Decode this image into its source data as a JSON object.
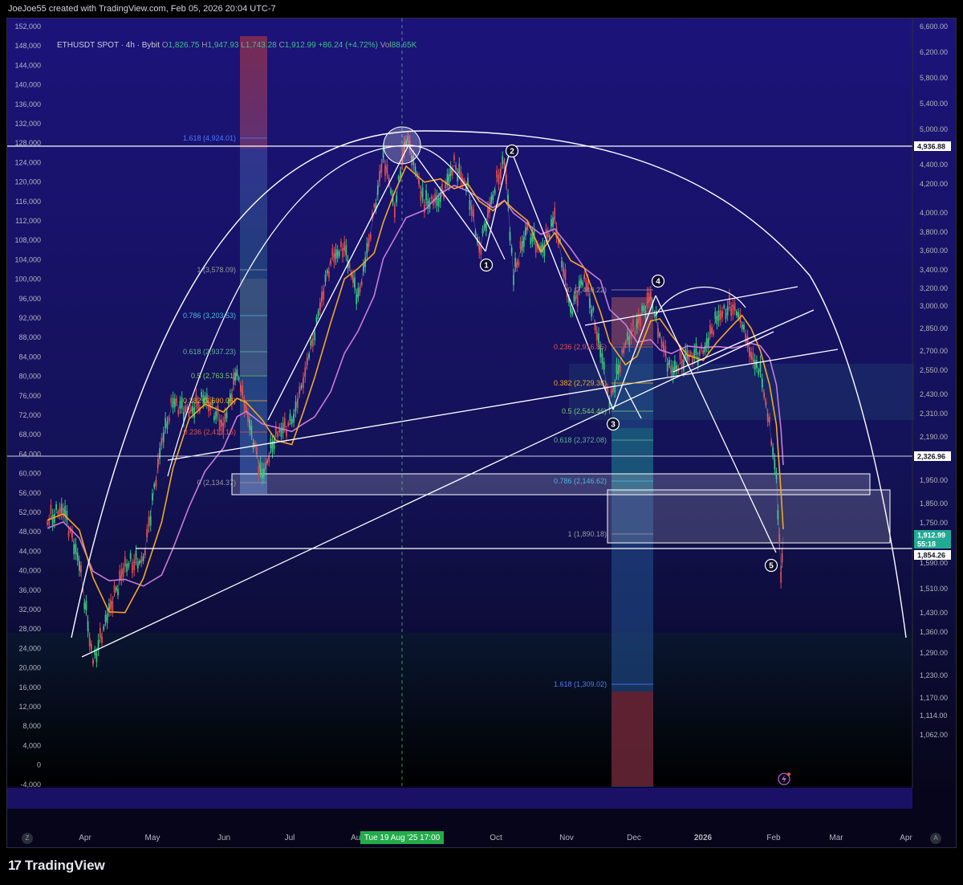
{
  "header": {
    "credit": "JoeJoe55 created with TradingView.com, Feb 05, 2026 20:04 UTC-7"
  },
  "legend": {
    "symbol": "ETHUSDT SPOT · 4h · Bybit",
    "o_label": "O",
    "o": "1,826.75",
    "h_label": "H",
    "h": "1,947.93",
    "l_label": "L",
    "l": "1,743.28",
    "c_label": "C",
    "c": "1,912.99",
    "change": "+86.24 (+4.72%)",
    "vol_label": "Vol",
    "vol": "88.65K"
  },
  "chart_data": {
    "type": "line",
    "symbol": "ETHUSDT SPOT 4h Bybit",
    "left_axis_ticks": [
      "152,000",
      "148,000",
      "144,000",
      "140,000",
      "136,000",
      "132,000",
      "128,000",
      "124,000",
      "120,000",
      "116,000",
      "112,000",
      "108,000",
      "104,000",
      "100,000",
      "96,000",
      "92,000",
      "88,000",
      "84,000",
      "80,000",
      "76,000",
      "72,000",
      "68,000",
      "64,000",
      "60,000",
      "56,000",
      "52,000",
      "48,000",
      "44,000",
      "40,000",
      "36,000",
      "32,000",
      "28,000",
      "24,000",
      "20,000",
      "16,000",
      "12,000",
      "8,000",
      "4,000",
      "0",
      "-4,000"
    ],
    "right_axis_ticks": [
      "6,600.00",
      "6,200.00",
      "5,800.00",
      "5,400.00",
      "5,000.00",
      "4,700.00",
      "4,400.00",
      "4,200.00",
      "4,000.00",
      "3,800.00",
      "3,600.00",
      "3,400.00",
      "3,200.00",
      "3,000.00",
      "2,850.00",
      "2,700.00",
      "2,550.00",
      "2,430.00",
      "2,310.00",
      "2,190.00",
      "2,070.00",
      "1,950.00",
      "1,850.00",
      "1,750.00",
      "1,670.00",
      "1,590.00",
      "1,510.00",
      "1,430.00",
      "1,360.00",
      "1,290.00",
      "1,230.00",
      "1,170.00",
      "1,114.00",
      "1,062.00"
    ],
    "x_axis_labels": [
      "Apr",
      "May",
      "Jun",
      "Jul",
      "Aug",
      "Sep",
      "Oct",
      "Nov",
      "Dec",
      "2026",
      "Feb",
      "Mar",
      "Apr"
    ],
    "crosshair_label": "Tue 19 Aug '25   17:00",
    "price_tags": [
      {
        "label": "4,936.88",
        "style": "white"
      },
      {
        "label": "2,326.96",
        "style": "white"
      },
      {
        "label": "1,912.99",
        "style": "green"
      },
      {
        "label": "55:18",
        "style": "green"
      },
      {
        "label": "1,854.26",
        "style": "white"
      }
    ],
    "fib_levels_1": [
      {
        "label": "1.618 (4,924.01)",
        "color": "#4d7cff"
      },
      {
        "label": "1 (3,578.09)",
        "color": "#9598a1"
      },
      {
        "label": "0.786 (3,203.53)",
        "color": "#4db6e0"
      },
      {
        "label": "0.618 (2,937.23)",
        "color": "#5fb39a"
      },
      {
        "label": "0.5 (2,763.51)",
        "color": "#7bc96f"
      },
      {
        "label": "0.382 (2,600.06)",
        "color": "#f5a623"
      },
      {
        "label": "0.236 (2,411.15)",
        "color": "#e05252"
      },
      {
        "label": "0 (2,134.37)",
        "color": "#9598a1"
      }
    ],
    "fib_levels_2": [
      {
        "label": "0 (3,440.22)",
        "color": "#9598a1"
      },
      {
        "label": "0.236 (2,916.85)",
        "color": "#e05252"
      },
      {
        "label": "0.382 (2,729.38)",
        "color": "#f5a623"
      },
      {
        "label": "0.5 (2,544.46)",
        "color": "#7bc96f"
      },
      {
        "label": "0.618 (2,372.08)",
        "color": "#5fb39a"
      },
      {
        "label": "0.786 (2,146.62)",
        "color": "#4db6e0"
      },
      {
        "label": "1 (1,890.18)",
        "color": "#9598a1"
      },
      {
        "label": "1.618 (1,309.02)",
        "color": "#4d7cff"
      }
    ],
    "wave_labels": [
      "1",
      "2",
      "3",
      "4",
      "5"
    ],
    "series": [
      {
        "values": [
          {
            "t": "2025-03-20",
            "p": 1990
          },
          {
            "t": "2025-03-27",
            "p": 2050
          },
          {
            "t": "2025-04-03",
            "p": 1800
          },
          {
            "t": "2025-04-09",
            "p": 1400
          },
          {
            "t": "2025-04-16",
            "p": 1600
          },
          {
            "t": "2025-04-23",
            "p": 1790
          },
          {
            "t": "2025-05-01",
            "p": 1810
          },
          {
            "t": "2025-05-09",
            "p": 2400
          },
          {
            "t": "2025-05-14",
            "p": 2650
          },
          {
            "t": "2025-05-21",
            "p": 2580
          },
          {
            "t": "2025-05-28",
            "p": 2680
          },
          {
            "t": "2025-06-05",
            "p": 2500
          },
          {
            "t": "2025-06-11",
            "p": 2850
          },
          {
            "t": "2025-06-15",
            "p": 2600
          },
          {
            "t": "2025-06-22",
            "p": 2200
          },
          {
            "t": "2025-06-28",
            "p": 2450
          },
          {
            "t": "2025-07-05",
            "p": 2520
          },
          {
            "t": "2025-07-10",
            "p": 2800
          },
          {
            "t": "2025-07-15",
            "p": 3150
          },
          {
            "t": "2025-07-22",
            "p": 3750
          },
          {
            "t": "2025-07-28",
            "p": 3850
          },
          {
            "t": "2025-08-03",
            "p": 3400
          },
          {
            "t": "2025-08-10",
            "p": 4200
          },
          {
            "t": "2025-08-14",
            "p": 4780
          },
          {
            "t": "2025-08-19",
            "p": 4250
          },
          {
            "t": "2025-08-24",
            "p": 4950
          },
          {
            "t": "2025-09-01",
            "p": 4300
          },
          {
            "t": "2025-09-08",
            "p": 4350
          },
          {
            "t": "2025-09-14",
            "p": 4700
          },
          {
            "t": "2025-09-20",
            "p": 4450
          },
          {
            "t": "2025-09-25",
            "p": 3830
          },
          {
            "t": "2025-10-01",
            "p": 4400
          },
          {
            "t": "2025-10-06",
            "p": 4750
          },
          {
            "t": "2025-10-10",
            "p": 3600
          },
          {
            "t": "2025-10-16",
            "p": 4050
          },
          {
            "t": "2025-10-22",
            "p": 3800
          },
          {
            "t": "2025-10-28",
            "p": 4150
          },
          {
            "t": "2025-11-04",
            "p": 3300
          },
          {
            "t": "2025-11-10",
            "p": 3600
          },
          {
            "t": "2025-11-17",
            "p": 3000
          },
          {
            "t": "2025-11-21",
            "p": 2650
          },
          {
            "t": "2025-11-28",
            "p": 3050
          },
          {
            "t": "2025-12-03",
            "p": 3200
          },
          {
            "t": "2025-12-09",
            "p": 3420
          },
          {
            "t": "2025-12-13",
            "p": 3100
          },
          {
            "t": "2025-12-18",
            "p": 2850
          },
          {
            "t": "2025-12-25",
            "p": 2950
          },
          {
            "t": "2026-01-01",
            "p": 2980
          },
          {
            "t": "2026-01-07",
            "p": 3250
          },
          {
            "t": "2026-01-14",
            "p": 3350
          },
          {
            "t": "2026-01-18",
            "p": 3200
          },
          {
            "t": "2026-01-22",
            "p": 2950
          },
          {
            "t": "2026-01-26",
            "p": 2850
          },
          {
            "t": "2026-01-30",
            "p": 2500
          },
          {
            "t": "2026-02-02",
            "p": 2200
          },
          {
            "t": "2026-02-04",
            "p": 1750
          },
          {
            "t": "2026-02-05",
            "p": 1913
          }
        ]
      }
    ]
  }
}
